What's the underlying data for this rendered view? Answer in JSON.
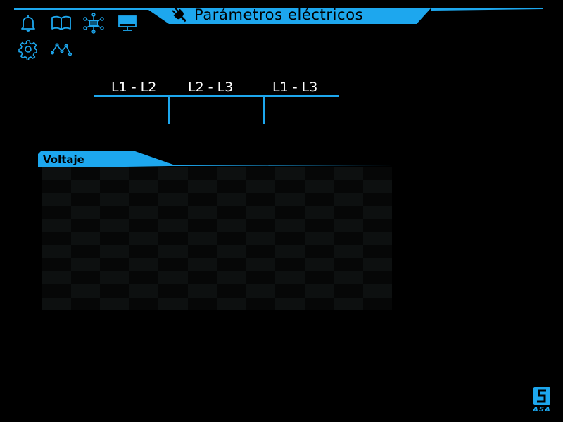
{
  "header": {
    "title": "Parámetros eléctricos",
    "title_icon": "plug-icon"
  },
  "nav": {
    "icons": [
      {
        "name": "bell-icon"
      },
      {
        "name": "book-icon"
      },
      {
        "name": "network-icon"
      },
      {
        "name": "monitor-icon"
      },
      {
        "name": "gear-icon"
      },
      {
        "name": "waveform-icon"
      }
    ]
  },
  "phases": {
    "tabs": [
      {
        "label": "L1 - L2"
      },
      {
        "label": "L2 - L3"
      },
      {
        "label": "L1 - L3"
      }
    ]
  },
  "section": {
    "title": "Voltaje"
  },
  "brand": {
    "name": "ASA"
  },
  "theme": {
    "background": "#000000",
    "accent": "#1da7ee",
    "title_text": "#000000",
    "grid_dark": "#060707",
    "grid_light": "#0d1010"
  }
}
